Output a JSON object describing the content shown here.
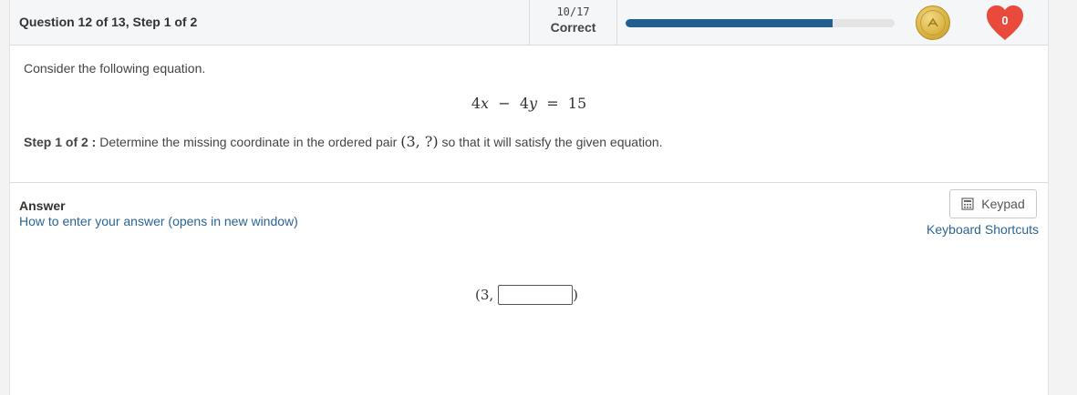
{
  "header": {
    "question_title": "Question 12 of 13, Step 1 of 2",
    "score_fraction": "10/17",
    "score_status": "Correct",
    "progress_percent": 77,
    "progress_color": "#1f5f91",
    "coin_icon": "coin-icon",
    "heart_icon": "heart-icon",
    "heart_count": "0",
    "heart_color": "#e84a3b"
  },
  "question": {
    "intro": "Consider the following equation.",
    "equation": {
      "left_coef": "4",
      "left_var": "x",
      "op": "−",
      "right_coef": "4",
      "right_var": "y",
      "eq": "=",
      "rhs": "15"
    },
    "step_label": "Step 1 of 2 :",
    "step_text_before": "Determine the missing coordinate in the ordered pair",
    "step_pair": "(3, ?)",
    "step_text_after": "so that it will satisfy the given equation."
  },
  "answer": {
    "label": "Answer",
    "help_link": "How to enter your answer (opens in new window)",
    "keypad_label": "Keypad",
    "keypad_icon": "calculator-icon",
    "shortcuts_link": "Keyboard Shortcuts",
    "pair_open": "(3,",
    "pair_close": ")",
    "input_value": ""
  }
}
